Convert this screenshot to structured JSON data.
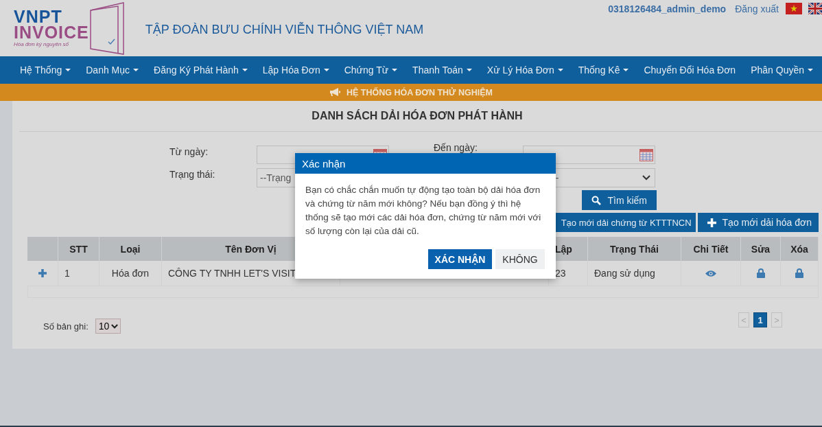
{
  "logo": {
    "line_1": "VNPT",
    "line_2": "INVOICE",
    "tagline": "Hóa đơn ký nguyên số"
  },
  "header": {
    "title": "TẬP ĐOÀN BƯU CHÍNH VIỄN THÔNG VIỆT NAM",
    "user": "0318126484_admin_demo",
    "logout": "Đăng xuất"
  },
  "nav": [
    {
      "label": "Hệ Thống",
      "has_dropdown": true
    },
    {
      "label": "Danh Mục",
      "has_dropdown": true
    },
    {
      "label": "Đăng Ký Phát Hành",
      "has_dropdown": true
    },
    {
      "label": "Lập Hóa Đơn",
      "has_dropdown": true
    },
    {
      "label": "Chứng Từ",
      "has_dropdown": true
    },
    {
      "label": "Thanh Toán",
      "has_dropdown": true
    },
    {
      "label": "Xử Lý Hóa Đơn",
      "has_dropdown": true
    },
    {
      "label": "Thống Kê",
      "has_dropdown": true
    },
    {
      "label": "Chuyển Đổi Hóa Đơn",
      "has_dropdown": false
    },
    {
      "label": "Phân Quyền",
      "has_dropdown": true
    }
  ],
  "banner": "HỆ THỐNG HÓA ĐƠN THỬ NGHIỆM",
  "page_title": "DANH SÁCH DẢI HÓA ĐƠN PHÁT HÀNH",
  "filters": {
    "from_label": "Từ ngày:",
    "to_label": "Đến ngày:",
    "status_label": "Trạng thái:",
    "status_value": "--Trạng",
    "status_2_value": "--",
    "search_button": "Tìm kiếm"
  },
  "actions": [
    "Tạo mới dải chứng từ KTTTNCN",
    "Tạo mới dải hóa đơn"
  ],
  "table": {
    "columns": [
      "STT",
      "Loại",
      "Tên Đơn Vị",
      "Lập",
      "Trạng Thái",
      "Chi Tiết",
      "Sửa",
      "Xóa"
    ],
    "rows": [
      {
        "stt": "1",
        "type": "Hóa đơn",
        "unit": "CÔNG TY TNHH LET'S VISIT",
        "column_5": "23",
        "status": "Đang sử dụng"
      }
    ]
  },
  "footer": {
    "page_size_label": "Số bản ghi:",
    "page_size": "10",
    "pages": [
      {
        "label": "<",
        "selected": false
      },
      {
        "label": "1",
        "selected": true
      },
      {
        "label": ">",
        "selected": false
      }
    ]
  },
  "dialog": {
    "title": "Xác nhận",
    "message": "Bạn có chắc chắn muốn tự động tạo toàn bộ dải hóa đơn và chứng từ năm mới không? Nếu bạn đồng ý thì hệ thống sẽ tạo mới các dải hóa đơn, chứng từ năm mới với số lượng còn lại của dải cũ.",
    "confirm": "XÁC NHẬN",
    "cancel": "KHÔNG"
  }
}
